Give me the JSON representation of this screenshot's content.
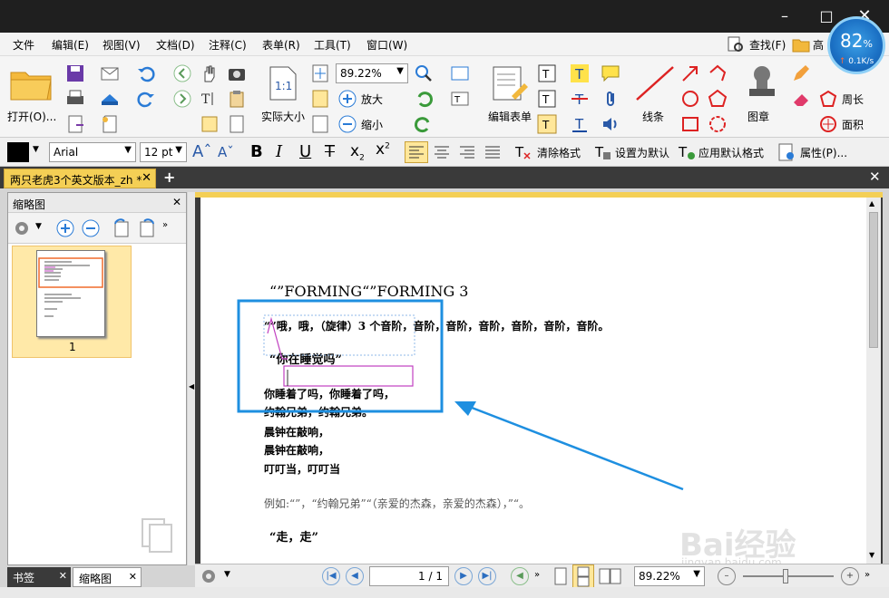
{
  "menu": [
    "文件",
    "编辑(E)",
    "视图(V)",
    "文档(D)",
    "注释(C)",
    "表单(R)",
    "工具(T)",
    "窗口(W)"
  ],
  "menu_right": {
    "find": "查找(F)",
    "high": "高"
  },
  "badge": {
    "percent": "82",
    "unit": "%",
    "speed": "0.1K/s"
  },
  "toolbar": {
    "open": "打开(O)...",
    "zoom_value": "89.22%",
    "actual_size": "实际大小",
    "zoom_in": "放大",
    "zoom_out": "缩小",
    "edit_form": "编辑表单",
    "lines": "线条",
    "stamp": "图章",
    "perimeter": "周长",
    "area": "面积"
  },
  "format": {
    "font": "Arial",
    "size": "12 pt",
    "clear": "清除格式",
    "set_default": "设置为默认",
    "apply_default": "应用默认格式",
    "properties": "属性(P)..."
  },
  "tab": {
    "title": "两只老虎3个英文版本_zh *"
  },
  "side": {
    "title": "缩略图",
    "page_num": "1",
    "tab_bookmarks": "书签",
    "tab_thumbs": "缩略图"
  },
  "status": {
    "page": "1 / 1",
    "zoom": "89.22%"
  },
  "doc": {
    "title": "“”FORMING“”FORMING 3",
    "line1": "“”哦，哦，（旋律）3 个音阶，音阶，音阶，音阶，音阶，音阶，音阶。",
    "line2": "“你在睡觉吗”",
    "line3": "你睡着了吗，你睡着了吗，",
    "line4": "约翰兄弟，约翰兄弟。",
    "line5": "晨钟在敲响，",
    "line6": "晨钟在敲响，",
    "line7": "叮叮当，叮叮当",
    "line8": "例如:“”，“约翰兄弟”“（亲爱的杰森，亲爱的杰森），”“。",
    "line9": "“走，走”"
  },
  "watermark": {
    "brand": "Bai经验",
    "url": "jingyan.baidu.com"
  },
  "colors": {
    "accent": "#f4cf55",
    "highlight_box": "#1e8fe0",
    "arrow": "#1e8fe0",
    "annot": "#c040c0"
  }
}
